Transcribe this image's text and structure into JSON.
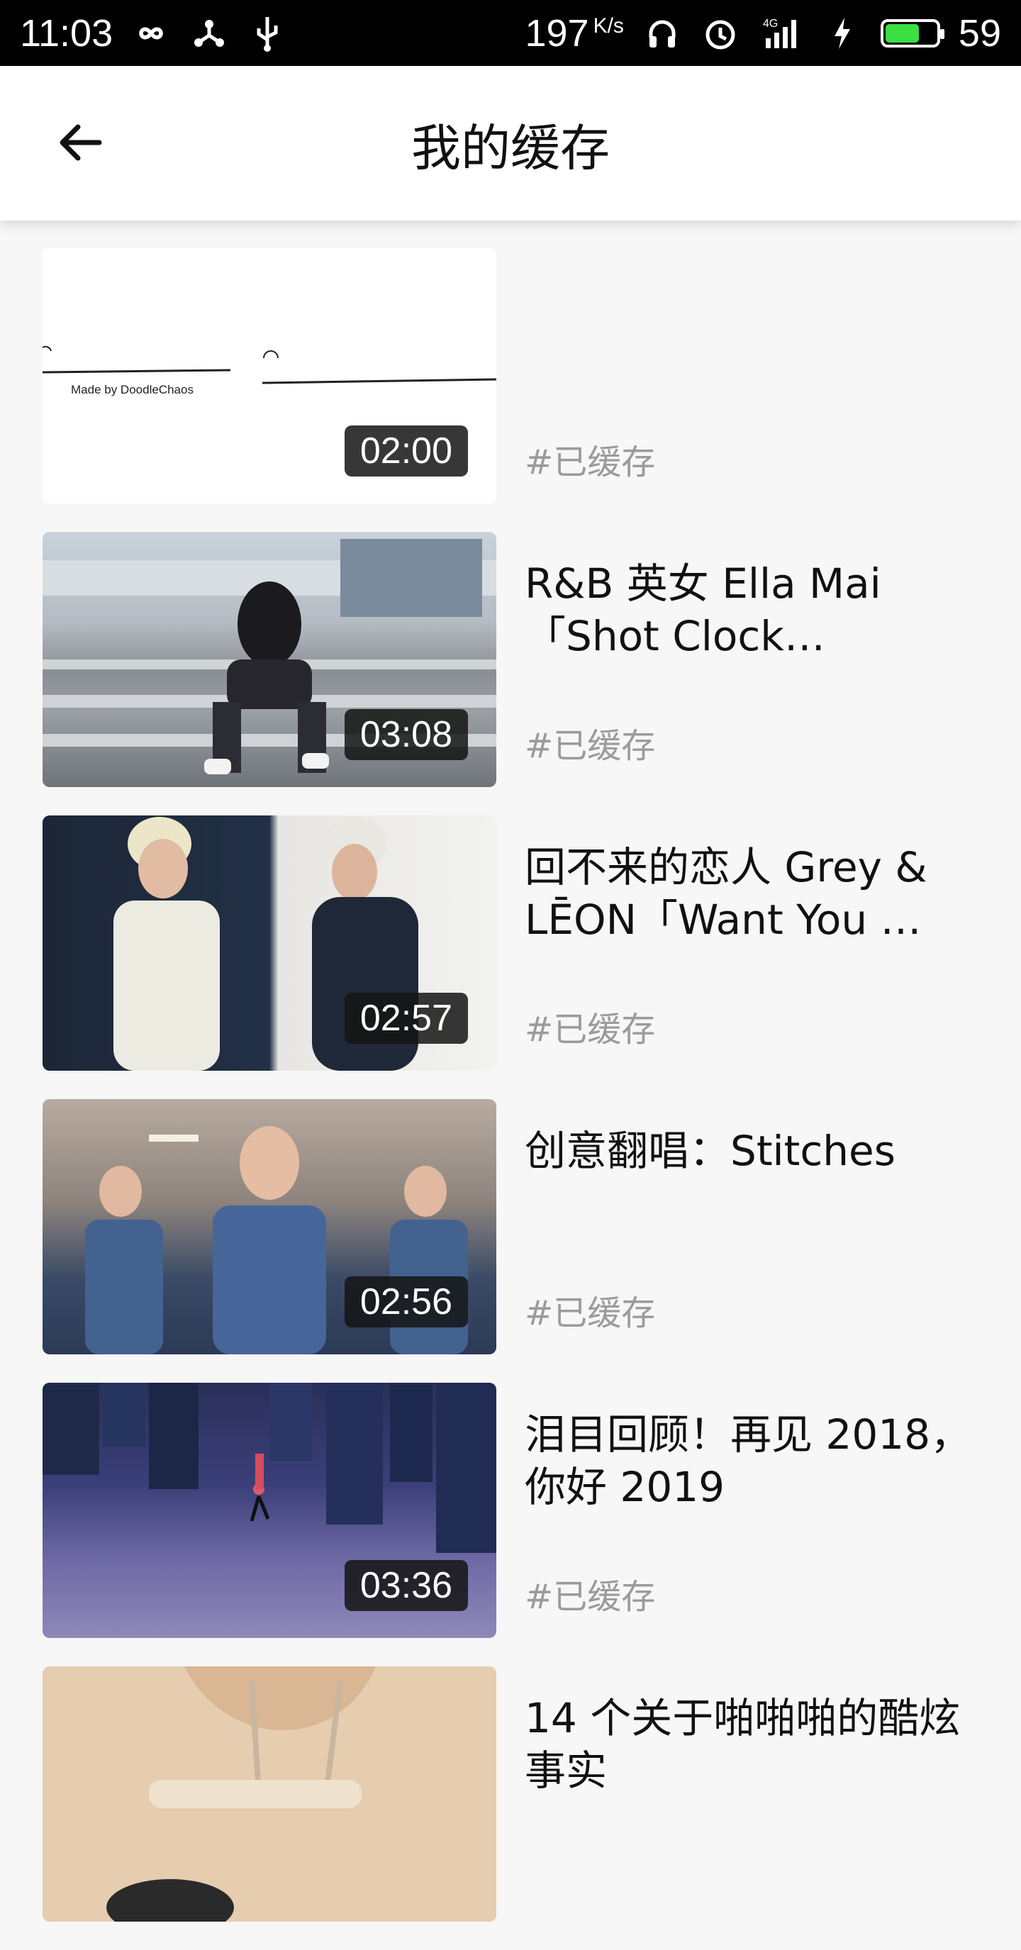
{
  "status_bar": {
    "time": "11:03",
    "speed_value": "197",
    "speed_unit": "K/s",
    "network": "4G",
    "battery_level": "59",
    "battery_fill_fraction": 0.62,
    "icons": [
      "infinity-icon",
      "share-icon",
      "usb-icon",
      "headphones-icon",
      "alarm-icon",
      "signal-icon",
      "charging-icon",
      "battery-icon"
    ]
  },
  "header": {
    "title": "我的缓存",
    "back_icon": "arrow-left-icon"
  },
  "videos": [
    {
      "title": "",
      "duration": "02:00",
      "tag": "#已缓存",
      "thumb_text": "Made by DoodleChaos"
    },
    {
      "title": "R&B 英女 Ella Mai「Shot Clock…",
      "duration": "03:08",
      "tag": "#已缓存"
    },
    {
      "title": "回不来的恋人 Grey & LĒON「Want You …",
      "duration": "02:57",
      "tag": "#已缓存"
    },
    {
      "title": "创意翻唱：Stitches",
      "duration": "02:56",
      "tag": "#已缓存"
    },
    {
      "title": "泪目回顾！再见 2018，你好 2019",
      "duration": "03:36",
      "tag": "#已缓存"
    },
    {
      "title": "14 个关于啪啪啪的酷炫事实",
      "duration": "",
      "tag": ""
    }
  ],
  "colors": {
    "page_bg": "#f7f7f8",
    "tag": "#9b9b9b",
    "status_bar": "#000000",
    "battery_fill": "#3adf41"
  }
}
